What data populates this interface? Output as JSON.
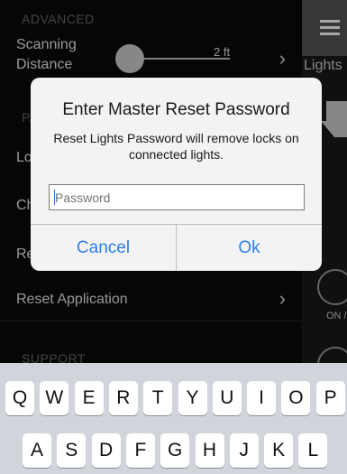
{
  "settings": {
    "advanced_header": "ADVANCED",
    "scanning_label_line1": "Scanning",
    "scanning_label_line2": "Distance",
    "scanning_value": "2 ft",
    "row_lo": "Lo",
    "row_ch": "Ch",
    "row_re": "Re",
    "reset_application": "Reset Application",
    "support_header": "SUPPORT",
    "section_pa": "PA"
  },
  "sidebar": {
    "lights_label": "Lights",
    "on_off_label": "ON /"
  },
  "dialog": {
    "title": "Enter Master Reset Password",
    "message": "Reset Lights Password will remove locks on connected lights.",
    "password_placeholder": "Password",
    "cancel_label": "Cancel",
    "ok_label": "Ok"
  },
  "keyboard": {
    "row1": [
      "Q",
      "W",
      "E",
      "R",
      "T",
      "Y",
      "U",
      "I",
      "O",
      "P"
    ],
    "row2": [
      "A",
      "S",
      "D",
      "F",
      "G",
      "H",
      "J",
      "K",
      "L"
    ]
  },
  "colors": {
    "accent": "#2f7fe6",
    "background": "#0a0a0a",
    "dialog_bg": "#f3f3f3",
    "keyboard_bg": "#d1d5db"
  }
}
